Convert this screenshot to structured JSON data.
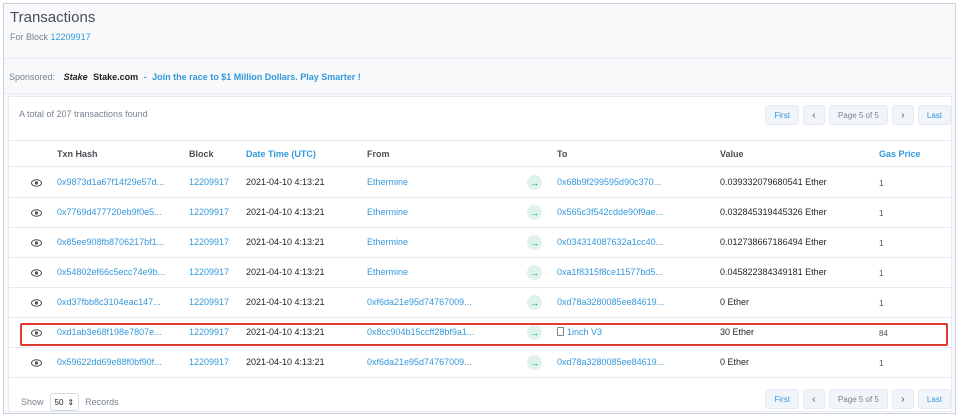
{
  "header": {
    "title": "Transactions",
    "subtitle_prefix": "For Block",
    "block_number": "12209917"
  },
  "sponsor": {
    "label": "Sponsored:",
    "brand_logo": "Stake",
    "brand_name": "Stake.com",
    "dash": "-",
    "message": "Join the race to $1 Million Dollars. Play Smarter !"
  },
  "summary": {
    "total_text": "A total of 207 transactions found"
  },
  "pagination": {
    "first": "First",
    "prev": "‹",
    "page_info": "Page 5 of 5",
    "next": "›",
    "last": "Last"
  },
  "table": {
    "columns": {
      "txn_hash": "Txn Hash",
      "block": "Block",
      "date_time": "Date Time (UTC)",
      "from": "From",
      "to": "To",
      "value": "Value",
      "gas_price": "Gas Price"
    },
    "rows": [
      {
        "hash": "0x9873d1a67f14f29e57d...",
        "block": "12209917",
        "time": "2021-04-10 4:13:21",
        "from": "Ethermine",
        "to": "0x68b9f299595d90c370...",
        "value": "0.039332079680541 Ether",
        "gas": "1"
      },
      {
        "hash": "0x7769d477720eb9f0e5...",
        "block": "12209917",
        "time": "2021-04-10 4:13:21",
        "from": "Ethermine",
        "to": "0x565c3f542cdde90f9ae...",
        "value": "0.032845319445326 Ether",
        "gas": "1"
      },
      {
        "hash": "0x85ee908fb8706217bf1...",
        "block": "12209917",
        "time": "2021-04-10 4:13:21",
        "from": "Ethermine",
        "to": "0x034314087632a1cc40...",
        "value": "0.012738667186494 Ether",
        "gas": "1"
      },
      {
        "hash": "0x54802ef66c5ecc74e9b...",
        "block": "12209917",
        "time": "2021-04-10 4:13:21",
        "from": "Ethermine",
        "to": "0xa1f8315f8ce11577bd5...",
        "value": "0.045822384349181 Ether",
        "gas": "1"
      },
      {
        "hash": "0xd37fbb8c3104eac147...",
        "block": "12209917",
        "time": "2021-04-10 4:13:21",
        "from": "0xf6da21e95d74767009...",
        "to": "0xd78a3280085ee84619...",
        "value": "0 Ether",
        "gas": "1"
      },
      {
        "hash": "0xd1ab3e68f198e7807e...",
        "block": "12209917",
        "time": "2021-04-10 4:13:21",
        "from": "0x8cc904b15ccff28bf9a1...",
        "to": "1inch V3",
        "value": "30 Ether",
        "gas": "84"
      },
      {
        "hash": "0x59622dd69e88f0bf90f...",
        "block": "12209917",
        "time": "2021-04-10 4:13:21",
        "from": "0xf6da21e95d74767009...",
        "to": "0xd78a3280085ee84619...",
        "value": "0 Ether",
        "gas": "1"
      }
    ]
  },
  "footer": {
    "show_label": "Show",
    "page_size": "50",
    "records_label": "Records"
  },
  "colors": {
    "link": "#3498db",
    "highlight": "#e03a2f",
    "arrow_green": "#00a186"
  }
}
